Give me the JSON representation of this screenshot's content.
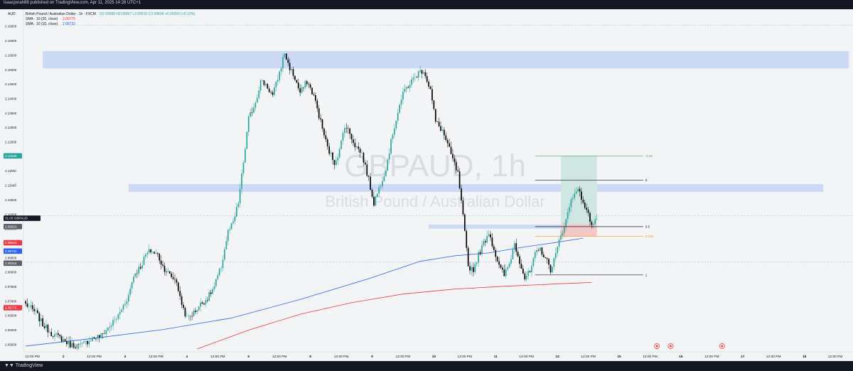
{
  "header": {
    "published": "Isaacjonah88 published on TradingView.com, Apr 11, 2025 14:28 UTC+1",
    "currency": "AUD",
    "title_line": "British Pound / Australian Dollar · 1h · FXCM",
    "ohlc": "O2.09588 H2.09957 L2.09510 C2.09838 +0.00250 (+0.12%)",
    "sma20_label": "SMA · 10 (20, close)",
    "sma20_value": "2.06775",
    "sma10_label": "SMA · 10 (10, close)",
    "sma10_value": "2.08732"
  },
  "watermark": {
    "symbol": "GBPAUD, 1h",
    "name": "British Pound / Australian Dollar"
  },
  "footer": {
    "brand": "TradingView"
  },
  "colors": {
    "up": "#26a69a",
    "down": "#000000",
    "sma20": "#f23645",
    "sma10": "#2962ff",
    "zone": "#c5d5f5",
    "profit": "#cfe6e2",
    "loss": "#f4c7c7",
    "fib_green": "#4caf50",
    "fib_orange": "#ff9800"
  },
  "chart_data": {
    "type": "candlestick",
    "symbol": "GBPAUD",
    "timeframe": "1h",
    "x_labels": [
      {
        "i": 4,
        "label": "12:00 PM"
      },
      {
        "i": 22,
        "label": "2"
      },
      {
        "i": 40,
        "label": "12:00 PM"
      },
      {
        "i": 58,
        "label": "3"
      },
      {
        "i": 76,
        "label": "12:00 PM"
      },
      {
        "i": 94,
        "label": "4"
      },
      {
        "i": 112,
        "label": "12:00 PM"
      },
      {
        "i": 130,
        "label": "6"
      },
      {
        "i": 148,
        "label": "12:00 PM"
      },
      {
        "i": 166,
        "label": "8"
      },
      {
        "i": 184,
        "label": "12:00 PM"
      },
      {
        "i": 202,
        "label": "9"
      },
      {
        "i": 220,
        "label": "12:00 PM"
      },
      {
        "i": 238,
        "label": "10"
      },
      {
        "i": 256,
        "label": "12:00 PM"
      },
      {
        "i": 274,
        "label": "11"
      },
      {
        "i": 292,
        "label": "12:00 PM"
      },
      {
        "i": 310,
        "label": "13"
      },
      {
        "i": 328,
        "label": "12:00 PM"
      },
      {
        "i": 346,
        "label": "15"
      },
      {
        "i": 364,
        "label": "12:00 PM"
      },
      {
        "i": 382,
        "label": "16"
      },
      {
        "i": 400,
        "label": "12:00 PM"
      },
      {
        "i": 418,
        "label": "17"
      },
      {
        "i": 436,
        "label": "12:00 PM"
      },
      {
        "i": 454,
        "label": "18"
      },
      {
        "i": 472,
        "label": "12:00 PM"
      }
    ],
    "y_ticks": [
      2.055,
      2.06,
      2.065,
      2.07,
      2.075,
      2.08,
      2.085,
      2.09,
      2.095,
      2.1,
      2.105,
      2.11,
      2.115,
      2.12,
      2.125,
      2.13,
      2.135,
      2.14,
      2.145,
      2.15,
      2.155,
      2.16,
      2.165
    ],
    "y_tick_labels": [
      "2.05500",
      "2.06000",
      "2.06500",
      "2.07000",
      "2.07500",
      "2.08000",
      "2.08500",
      "2.09000",
      "2.09500",
      "2.10000",
      "2.10500",
      "2.11000",
      "2.11500",
      "2.12000",
      "2.12500",
      "2.13000",
      "2.13500",
      "2.14000",
      "2.14500",
      "2.15000",
      "2.15500",
      "2.16000",
      "2.16500"
    ],
    "ylim": [
      2.0535,
      2.168
    ],
    "x_count": 480,
    "price_badges": [
      {
        "label": "2.12025",
        "value": 2.12025,
        "color": "#26a69a"
      },
      {
        "label": "31:05  GBPAUD",
        "value": 2.0987,
        "color": "#131722"
      },
      {
        "label": "2.09522",
        "value": 2.0958,
        "color": "#5d606b"
      },
      {
        "label": "2.09023",
        "value": 2.09023,
        "color": "#f23645"
      },
      {
        "label": "2.08732",
        "value": 2.08732,
        "color": "#2962ff"
      },
      {
        "label": "2.08316",
        "value": 2.08316,
        "color": "#5d606b"
      },
      {
        "label": "2.06775",
        "value": 2.06775,
        "color": "#f23645"
      }
    ],
    "anchors": [
      [
        0,
        2.069
      ],
      [
        6,
        2.066
      ],
      [
        10,
        2.062
      ],
      [
        15,
        2.059
      ],
      [
        21,
        2.057
      ],
      [
        26,
        2.055
      ],
      [
        32,
        2.0545
      ],
      [
        38,
        2.057
      ],
      [
        44,
        2.058
      ],
      [
        50,
        2.062
      ],
      [
        54,
        2.065
      ],
      [
        60,
        2.072
      ],
      [
        63,
        2.079
      ],
      [
        67,
        2.082
      ],
      [
        70,
        2.086
      ],
      [
        73,
        2.0875
      ],
      [
        77,
        2.086
      ],
      [
        80,
        2.082
      ],
      [
        84,
        2.079
      ],
      [
        88,
        2.077
      ],
      [
        90,
        2.071
      ],
      [
        94,
        2.064
      ],
      [
        98,
        2.066
      ],
      [
        102,
        2.069
      ],
      [
        106,
        2.071
      ],
      [
        110,
        2.075
      ],
      [
        114,
        2.082
      ],
      [
        118,
        2.094
      ],
      [
        121,
        2.097
      ],
      [
        124,
        2.104
      ],
      [
        127,
        2.118
      ],
      [
        130,
        2.133
      ],
      [
        134,
        2.139
      ],
      [
        137,
        2.146
      ],
      [
        140,
        2.145
      ],
      [
        144,
        2.141
      ],
      [
        148,
        2.149
      ],
      [
        151,
        2.156
      ],
      [
        153,
        2.152
      ],
      [
        157,
        2.147
      ],
      [
        160,
        2.142
      ],
      [
        164,
        2.146
      ],
      [
        168,
        2.141
      ],
      [
        172,
        2.132
      ],
      [
        176,
        2.123
      ],
      [
        180,
        2.118
      ],
      [
        183,
        2.122
      ],
      [
        186,
        2.131
      ],
      [
        189,
        2.128
      ],
      [
        192,
        2.124
      ],
      [
        196,
        2.121
      ],
      [
        200,
        2.112
      ],
      [
        203,
        2.104
      ],
      [
        206,
        2.109
      ],
      [
        210,
        2.116
      ],
      [
        214,
        2.128
      ],
      [
        218,
        2.138
      ],
      [
        221,
        2.143
      ],
      [
        225,
        2.146
      ],
      [
        229,
        2.149
      ],
      [
        232,
        2.15
      ],
      [
        236,
        2.143
      ],
      [
        239,
        2.132
      ],
      [
        243,
        2.129
      ],
      [
        246,
        2.124
      ],
      [
        249,
        2.119
      ],
      [
        252,
        2.114
      ],
      [
        255,
        2.099
      ],
      [
        258,
        2.082
      ],
      [
        261,
        2.081
      ],
      [
        264,
        2.086
      ],
      [
        267,
        2.09
      ],
      [
        270,
        2.094
      ],
      [
        273,
        2.088
      ],
      [
        276,
        2.082
      ],
      [
        279,
        2.079
      ],
      [
        282,
        2.083
      ],
      [
        285,
        2.09
      ],
      [
        288,
        2.084
      ],
      [
        291,
        2.078
      ],
      [
        294,
        2.08
      ],
      [
        297,
        2.086
      ],
      [
        300,
        2.088
      ],
      [
        303,
        2.085
      ],
      [
        306,
        2.081
      ],
      [
        309,
        2.086
      ],
      [
        312,
        2.093
      ],
      [
        315,
        2.098
      ],
      [
        318,
        2.105
      ],
      [
        321,
        2.109
      ],
      [
        324,
        2.106
      ],
      [
        327,
        2.101
      ],
      [
        330,
        2.097
      ],
      [
        333,
        2.0984
      ]
    ],
    "sma20": [
      [
        100,
        2.0535
      ],
      [
        130,
        2.06
      ],
      [
        160,
        2.0655
      ],
      [
        190,
        2.0695
      ],
      [
        220,
        2.0725
      ],
      [
        250,
        2.0742
      ],
      [
        280,
        2.0752
      ],
      [
        310,
        2.076
      ],
      [
        330,
        2.0765
      ]
    ],
    "sma10": [
      [
        0,
        2.0545
      ],
      [
        40,
        2.0572
      ],
      [
        80,
        2.0602
      ],
      [
        120,
        2.0642
      ],
      [
        160,
        2.0706
      ],
      [
        200,
        2.0778
      ],
      [
        230,
        2.0838
      ],
      [
        250,
        2.0857
      ],
      [
        270,
        2.0867
      ],
      [
        290,
        2.0887
      ],
      [
        310,
        2.0904
      ],
      [
        325,
        2.0918
      ]
    ],
    "zones": [
      {
        "x0": 10,
        "x1": 480,
        "y0": 2.1505,
        "y1": 2.1565
      },
      {
        "x0": 60,
        "x1": 465,
        "y0": 2.1078,
        "y1": 2.1105
      },
      {
        "x0": 235,
        "x1": 330,
        "y0": 2.0951,
        "y1": 2.0965
      }
    ],
    "position": {
      "x0": 312,
      "x1": 333,
      "entry": 2.0966,
      "target": 2.12025,
      "stop": 2.0925
    },
    "fib": {
      "x0": 297,
      "x1": 360,
      "levels": [
        {
          "ratio": "-0.26",
          "value": 2.12025,
          "color": "#4caf50"
        },
        {
          "ratio": "0",
          "value": 2.1119,
          "color": "#131722"
        },
        {
          "ratio": "0.5",
          "value": 2.0958,
          "color": "#131722"
        },
        {
          "ratio": "0.618",
          "value": 2.0924,
          "color": "#ff9800"
        },
        {
          "ratio": "1",
          "value": 2.0791,
          "color": "#131722"
        }
      ]
    },
    "event_icons": [
      {
        "i": 368
      },
      {
        "i": 376
      },
      {
        "i": 406
      }
    ]
  }
}
